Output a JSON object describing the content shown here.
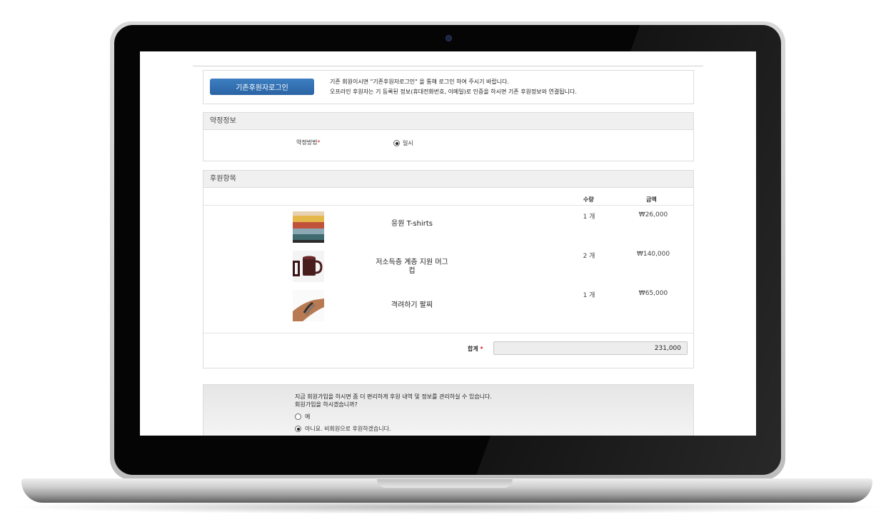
{
  "login": {
    "button": "기존후원자로그인",
    "line1": "기존 회원이시면 \"기존후원자로그인\" 을 통해 로그인 하여 주시기 바랍니다.",
    "line2": "오프라인 후원자는 기 등록된 정보(휴대전화번호, 이메일)로 인증을 하시면 기존 후원정보와 연결됩니다."
  },
  "pledge": {
    "title": "약정정보",
    "method_label": "약정방법",
    "required_mark": "*",
    "option": "일시"
  },
  "items": {
    "title": "후원항목",
    "col_qty": "수량",
    "col_amount": "금액",
    "rows": [
      {
        "name": "응원 T-shirts",
        "qty": "1 개",
        "amount": "₩26,000",
        "icon": "tshirt-stack-photo"
      },
      {
        "name": "저소득층 계층 지원 머그컵",
        "qty": "2 개",
        "amount": "₩140,000",
        "icon": "mug-photo"
      },
      {
        "name": "격려하기 팔찌",
        "qty": "1 개",
        "amount": "₩65,000",
        "icon": "bracelet-photo"
      }
    ],
    "total_label": "합계",
    "total_value": "231,000"
  },
  "join": {
    "line1": "지금 회원가입을 하시면 좀 더 편리하게 후원 내역 및 정보를 관리하실 수 있습니다.",
    "line2": "회원가입을 하시겠습니까?",
    "opt_yes": "예",
    "opt_no": "아니요. 비회원으로 후원하겠습니다.",
    "selected": "no"
  },
  "colors": {
    "button": "#2f6cb0",
    "required": "#e0141e",
    "section_header": "#f0f0f0"
  }
}
